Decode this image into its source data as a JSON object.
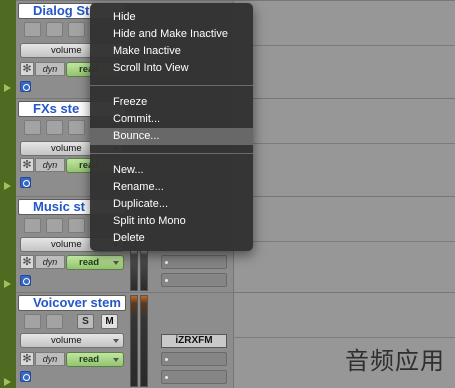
{
  "tracks": [
    {
      "name": "Dialog St",
      "volume": "volume",
      "dyn": "dyn",
      "auto": "read"
    },
    {
      "name": "FXs ste",
      "volume": "volume",
      "dyn": "dyn",
      "auto": "read"
    },
    {
      "name": "Music st",
      "volume": "volume",
      "dyn": "dyn",
      "auto": "read"
    },
    {
      "name": "Voicover stem",
      "volume": "volume",
      "dyn": "dyn",
      "auto": "read",
      "solo": "S",
      "mute": "M",
      "plugin": "iZRXFM"
    }
  ],
  "context_menu": {
    "group1": [
      "Hide",
      "Hide and Make Inactive",
      "Make Inactive",
      "Scroll Into View"
    ],
    "group2": [
      "Freeze",
      "Commit...",
      "Bounce..."
    ],
    "group3": [
      "New...",
      "Rename...",
      "Duplicate...",
      "Split into Mono",
      "Delete"
    ],
    "highlighted": "Bounce..."
  },
  "icons": {
    "freeze": "✻"
  },
  "watermark": "音频应用",
  "colors": {
    "track_color": "#4f6b22",
    "name_text": "#2457c7",
    "auto_read": "#a6d282",
    "menu_bg": "#323232",
    "menu_highlight": "#686868"
  }
}
